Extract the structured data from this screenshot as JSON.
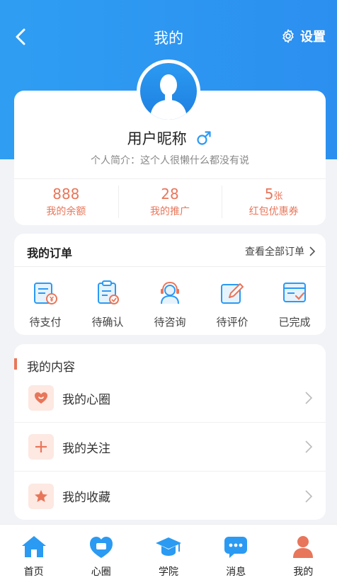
{
  "header": {
    "title": "我的",
    "settings_label": "设置",
    "accent": "#2b9af2"
  },
  "profile": {
    "nickname": "用户昵称",
    "bio": "个人简介：这个人很懒什么都没有说",
    "stats": [
      {
        "value": "888",
        "unit": "",
        "label": "我的余额"
      },
      {
        "value": "28",
        "unit": "",
        "label": "我的推广"
      },
      {
        "value": "5",
        "unit": "张",
        "label": "红包优惠券"
      }
    ],
    "stat_color": "#e8765a"
  },
  "orders": {
    "title": "我的订单",
    "view_all": "查看全部订单",
    "items": [
      {
        "label": "待支付",
        "icon": "payment-icon"
      },
      {
        "label": "待确认",
        "icon": "confirm-icon"
      },
      {
        "label": "待咨询",
        "icon": "consult-icon"
      },
      {
        "label": "待评价",
        "icon": "review-icon"
      },
      {
        "label": "已完成",
        "icon": "completed-icon"
      }
    ]
  },
  "content": {
    "title": "我的内容",
    "items": [
      {
        "label": "我的心圈",
        "icon": "heart-icon"
      },
      {
        "label": "我的关注",
        "icon": "plus-icon"
      },
      {
        "label": "我的收藏",
        "icon": "star-icon"
      }
    ]
  },
  "tabbar": {
    "items": [
      {
        "label": "首页",
        "icon": "home-icon"
      },
      {
        "label": "心圈",
        "icon": "heart-chat-icon"
      },
      {
        "label": "学院",
        "icon": "graduation-cap-icon"
      },
      {
        "label": "消息",
        "icon": "message-icon"
      },
      {
        "label": "我的",
        "icon": "profile-icon"
      }
    ]
  }
}
